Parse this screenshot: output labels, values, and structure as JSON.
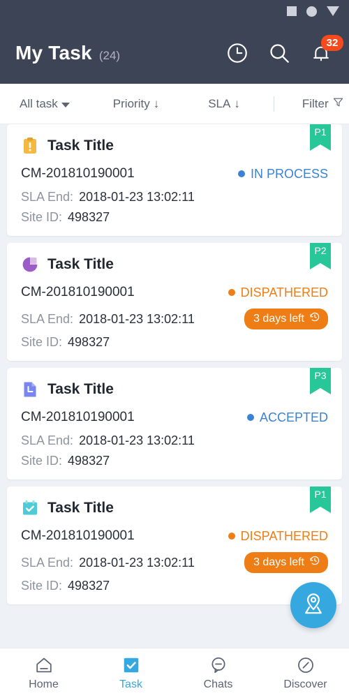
{
  "statusbar": {
    "icons": [
      "square-icon",
      "circle-icon",
      "triangle-down-icon"
    ]
  },
  "header": {
    "title": "My Task",
    "count": "(24)",
    "background": "#3d4455",
    "actions": [
      {
        "name": "history-icon",
        "label": "history"
      },
      {
        "name": "search-icon",
        "label": "search"
      },
      {
        "name": "notifications-icon",
        "label": "notifications",
        "badge": "32",
        "badge_color": "#f44a1e"
      }
    ]
  },
  "filterbar": {
    "all_task": "All task",
    "priority": "Priority",
    "priority_arrow": "↓",
    "sla": "SLA",
    "sla_arrow": "↓",
    "filter": "Filter"
  },
  "labels": {
    "sla_end": "SLA End:",
    "site_id": "Site ID:"
  },
  "colors": {
    "accent_blue": "#35a8e0",
    "status_blue": "#3b82d6",
    "status_orange": "#ef7d16",
    "ribbon_green": "#27c79a",
    "page_bg": "#eef2f7"
  },
  "tasks": [
    {
      "priority": "P1",
      "icon": "clipboard-alert-icon",
      "icon_color": "#f5b840",
      "title": "Task Title",
      "code": "CM-201810190001",
      "status": "IN PROCESS",
      "status_color": "#3b82d6",
      "sla_end": "2018-01-23 13:02:11",
      "site_id": "498327",
      "days_left": null
    },
    {
      "priority": "P2",
      "icon": "pie-chart-icon",
      "icon_color": "#9a5cc6",
      "title": "Task Title",
      "code": "CM-201810190001",
      "status": "DISPATHERED",
      "status_color": "#ef7d16",
      "sla_end": "2018-01-23 13:02:11",
      "site_id": "498327",
      "days_left": "3 days left"
    },
    {
      "priority": "P3",
      "icon": "document-icon",
      "icon_color": "#7986f0",
      "title": "Task Title",
      "code": "CM-201810190001",
      "status": "ACCEPTED",
      "status_color": "#3b82d6",
      "sla_end": "2018-01-23 13:02:11",
      "site_id": "498327",
      "days_left": null
    },
    {
      "priority": "P1",
      "icon": "calendar-check-icon",
      "icon_color": "#4ecbd6",
      "title": "Task Title",
      "code": "CM-201810190001",
      "status": "DISPATHERED",
      "status_color": "#ef7d16",
      "sla_end": "2018-01-23 13:02:11",
      "site_id": "498327",
      "days_left": "3 days left"
    }
  ],
  "fab": {
    "icon": "map-location-pin-icon",
    "color": "#35a8e0"
  },
  "bottomnav": {
    "items": [
      {
        "label": "Home",
        "icon": "home-icon",
        "active": false
      },
      {
        "label": "Task",
        "icon": "check-square-icon",
        "active": true
      },
      {
        "label": "Chats",
        "icon": "chat-bubble-icon",
        "active": false
      },
      {
        "label": "Discover",
        "icon": "compass-icon",
        "active": false
      }
    ]
  }
}
